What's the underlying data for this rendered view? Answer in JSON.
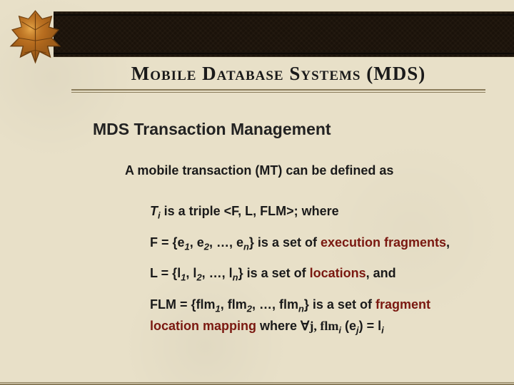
{
  "title": "Mobile Database Systems (MDS)",
  "subtitle": "MDS Transaction Management",
  "lead": "A mobile transaction (MT) can be defined as",
  "defs": {
    "triple_pre": "T",
    "triple_post": " is a triple <F, L, FLM>; where",
    "f_pre": "F = {e",
    "f_mid1": ", e",
    "f_mid2": ", …, e",
    "f_post": "} is a set of ",
    "f_hl": "execution fragments",
    "f_end": ",",
    "l_pre": "L = {l",
    "l_mid1": ", l",
    "l_mid2": ", …, l",
    "l_post": "} is a set of ",
    "l_hl": "locations",
    "l_end": ", and",
    "flm_pre": "FLM = {flm",
    "flm_mid1": ", flm",
    "flm_mid2": ", …, flm",
    "flm_post": "} is a set of ",
    "flm_hl": "fragment location mapping",
    "flm_where": " where ",
    "flm_forall": "∀j, flm",
    "flm_paren": " (e",
    "flm_eq": ") = l"
  },
  "subs": {
    "i": "i",
    "one": "1",
    "two": "2",
    "n": "n",
    "j": "j"
  }
}
